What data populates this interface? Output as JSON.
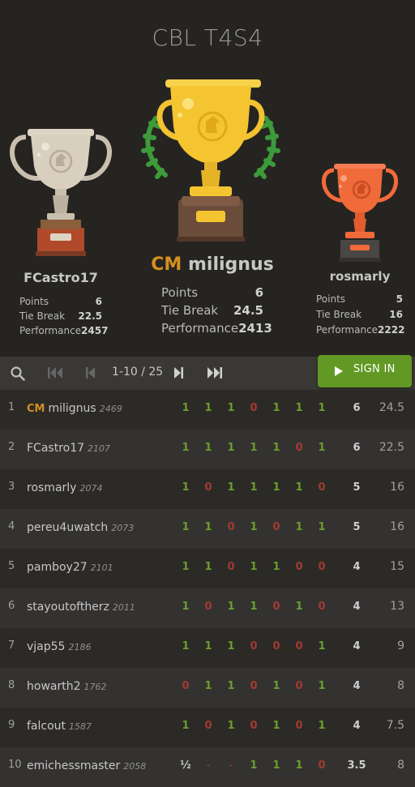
{
  "tournament": {
    "title": "CBL T4S4"
  },
  "podium": [
    {
      "place": 1,
      "title": "CM",
      "name": "milignus",
      "points": "6",
      "tiebreak": "24.5",
      "performance": "2413"
    },
    {
      "place": 2,
      "title": "",
      "name": "FCastro17",
      "points": "6",
      "tiebreak": "22.5",
      "performance": "2457"
    },
    {
      "place": 3,
      "title": "",
      "name": "rosmarly",
      "points": "5",
      "tiebreak": "16",
      "performance": "2222"
    }
  ],
  "labels": {
    "points": "Points",
    "tiebreak": "Tie Break",
    "performance": "Performance"
  },
  "toolbar": {
    "pager": "1-10 / 25",
    "signin": "SIGN IN"
  },
  "colors": {
    "accent_green": "#629924",
    "gold": "#d59020",
    "win": "#6a9f2c",
    "loss": "#a23a32"
  },
  "standings": [
    {
      "rank": "1",
      "title": "CM",
      "name": "milignus",
      "rating": "2469",
      "results": [
        "1",
        "1",
        "1",
        "0",
        "1",
        "1",
        "1"
      ],
      "score": "6",
      "tb": "24.5"
    },
    {
      "rank": "2",
      "title": "",
      "name": "FCastro17",
      "rating": "2107",
      "results": [
        "1",
        "1",
        "1",
        "1",
        "1",
        "0",
        "1"
      ],
      "score": "6",
      "tb": "22.5"
    },
    {
      "rank": "3",
      "title": "",
      "name": "rosmarly",
      "rating": "2074",
      "results": [
        "1",
        "0",
        "1",
        "1",
        "1",
        "1",
        "0"
      ],
      "score": "5",
      "tb": "16"
    },
    {
      "rank": "4",
      "title": "",
      "name": "pereu4uwatch",
      "rating": "2073",
      "results": [
        "1",
        "1",
        "0",
        "1",
        "0",
        "1",
        "1"
      ],
      "score": "5",
      "tb": "16"
    },
    {
      "rank": "5",
      "title": "",
      "name": "pamboy27",
      "rating": "2101",
      "results": [
        "1",
        "1",
        "0",
        "1",
        "1",
        "0",
        "0"
      ],
      "score": "4",
      "tb": "15"
    },
    {
      "rank": "6",
      "title": "",
      "name": "stayoutoftherz",
      "rating": "2011",
      "results": [
        "1",
        "0",
        "1",
        "1",
        "0",
        "1",
        "0"
      ],
      "score": "4",
      "tb": "13"
    },
    {
      "rank": "7",
      "title": "",
      "name": "vjap55",
      "rating": "2186",
      "results": [
        "1",
        "1",
        "1",
        "0",
        "0",
        "0",
        "1"
      ],
      "score": "4",
      "tb": "9"
    },
    {
      "rank": "8",
      "title": "",
      "name": "howarth2",
      "rating": "1762",
      "results": [
        "0",
        "1",
        "1",
        "0",
        "1",
        "0",
        "1"
      ],
      "score": "4",
      "tb": "8"
    },
    {
      "rank": "9",
      "title": "",
      "name": "falcout",
      "rating": "1587",
      "results": [
        "1",
        "0",
        "1",
        "0",
        "1",
        "0",
        "1"
      ],
      "score": "4",
      "tb": "7.5"
    },
    {
      "rank": "10",
      "title": "",
      "name": "emichessmaster",
      "rating": "2058",
      "results": [
        "½",
        "-",
        "-",
        "1",
        "1",
        "1",
        "0"
      ],
      "score": "3.5",
      "tb": "8"
    }
  ]
}
